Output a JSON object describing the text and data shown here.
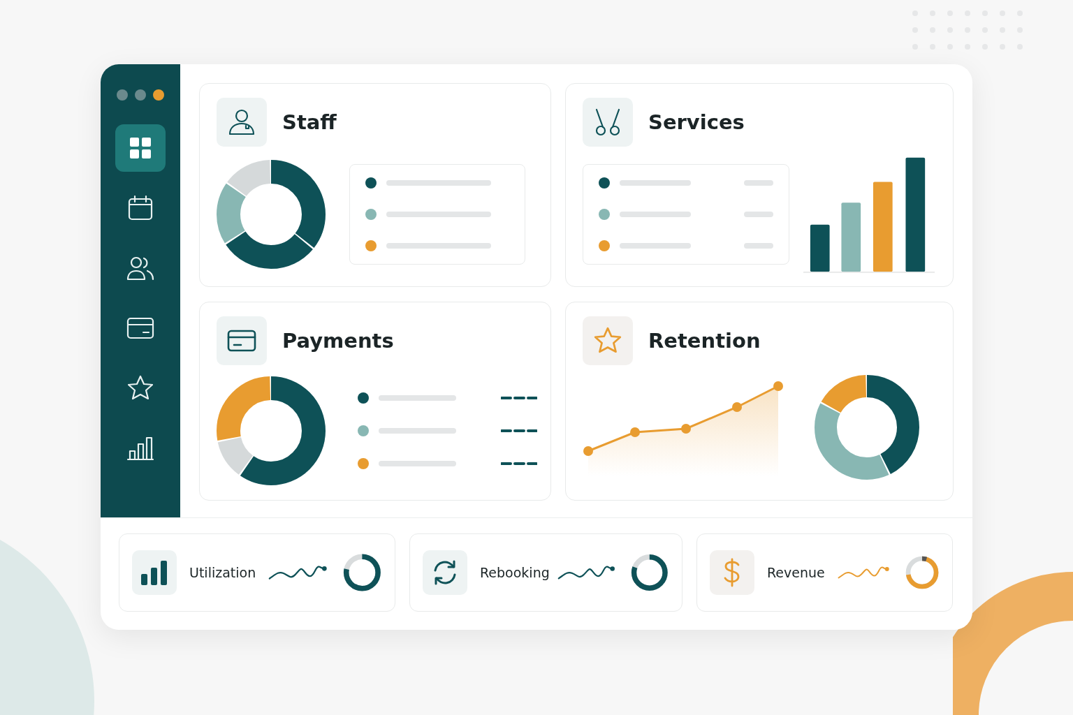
{
  "window_dots": [
    {
      "color": "#6b8a8d"
    },
    {
      "color": "#6b8a8d"
    },
    {
      "color": "#e89c30"
    }
  ],
  "sidebar": {
    "items": [
      {
        "kind": "grid",
        "selected": true
      },
      {
        "kind": "calendar",
        "selected": false
      },
      {
        "kind": "users",
        "selected": false
      },
      {
        "kind": "card",
        "selected": false
      },
      {
        "kind": "star",
        "selected": false
      },
      {
        "kind": "chart",
        "selected": false
      }
    ]
  },
  "cards": [
    {
      "kind": "staff",
      "title": "Staff",
      "legend": [
        {
          "color": "#0e5157"
        },
        {
          "color": "#88b7b3"
        },
        {
          "color": "#e89c30"
        }
      ]
    },
    {
      "kind": "services",
      "title": "Services",
      "legend": [
        {
          "color": "#0e5157"
        },
        {
          "color": "#88b7b3"
        },
        {
          "color": "#e89c30"
        }
      ]
    },
    {
      "kind": "payments",
      "title": "Payments",
      "legend": [
        {
          "color": "#0e5157"
        },
        {
          "color": "#88b7b3"
        },
        {
          "color": "#e89c30"
        }
      ]
    },
    {
      "kind": "retention",
      "title": "Retention"
    }
  ],
  "metrics": [
    {
      "kind": "utilization",
      "label": "Utilization",
      "color": "#0e5157",
      "level": 0.78
    },
    {
      "kind": "rebooking",
      "label": "Rebooking",
      "color": "#0e5157",
      "level": 0.8
    },
    {
      "kind": "revenue",
      "label": "Revenue",
      "color": "#e89c30",
      "level": 0.72
    }
  ]
}
